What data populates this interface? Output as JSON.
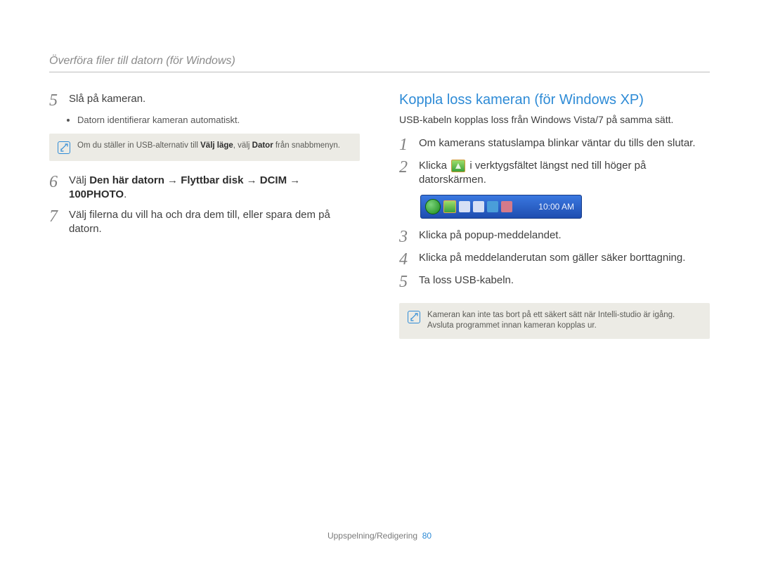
{
  "header": {
    "title": "Överföra filer till datorn (för Windows)"
  },
  "left": {
    "step5": {
      "num": "5",
      "text": "Slå på kameran.",
      "bullet": "Datorn identifierar kameran automatiskt."
    },
    "note1": {
      "pre": "Om du ställer in USB-alternativ till ",
      "b1": "Välj läge",
      "mid": ", välj ",
      "b2": "Dator",
      "post": " från snabbmenyn."
    },
    "step6": {
      "num": "6",
      "pre": "Välj ",
      "b1": "Den här datorn",
      "arrow": " → ",
      "b2": "Flyttbar disk",
      "b3": "DCIM",
      "b4": "100PHOTO",
      "post": "."
    },
    "step7": {
      "num": "7",
      "text": "Välj filerna du vill ha och dra dem till, eller spara dem på datorn."
    }
  },
  "right": {
    "title": "Koppla loss kameran (för Windows XP)",
    "subtitle": "USB-kabeln kopplas loss från Windows Vista/7 på samma sätt.",
    "step1": {
      "num": "1",
      "text": "Om kamerans statuslampa blinkar väntar du tills den slutar."
    },
    "step2": {
      "num": "2",
      "pre": "Klicka ",
      "post": " i verktygsfältet längst ned till höger på datorskärmen."
    },
    "taskbar": {
      "time": "10:00 AM"
    },
    "step3": {
      "num": "3",
      "text": "Klicka på popup-meddelandet."
    },
    "step4": {
      "num": "4",
      "text": "Klicka på meddelanderutan som gäller säker borttagning."
    },
    "step5": {
      "num": "5",
      "text": "Ta loss USB-kabeln."
    },
    "note2": {
      "text": "Kameran kan inte tas bort på ett säkert sätt när Intelli-studio är igång. Avsluta programmet innan kameran kopplas ur."
    }
  },
  "footer": {
    "section": "Uppspelning/Redigering",
    "page": "80"
  }
}
